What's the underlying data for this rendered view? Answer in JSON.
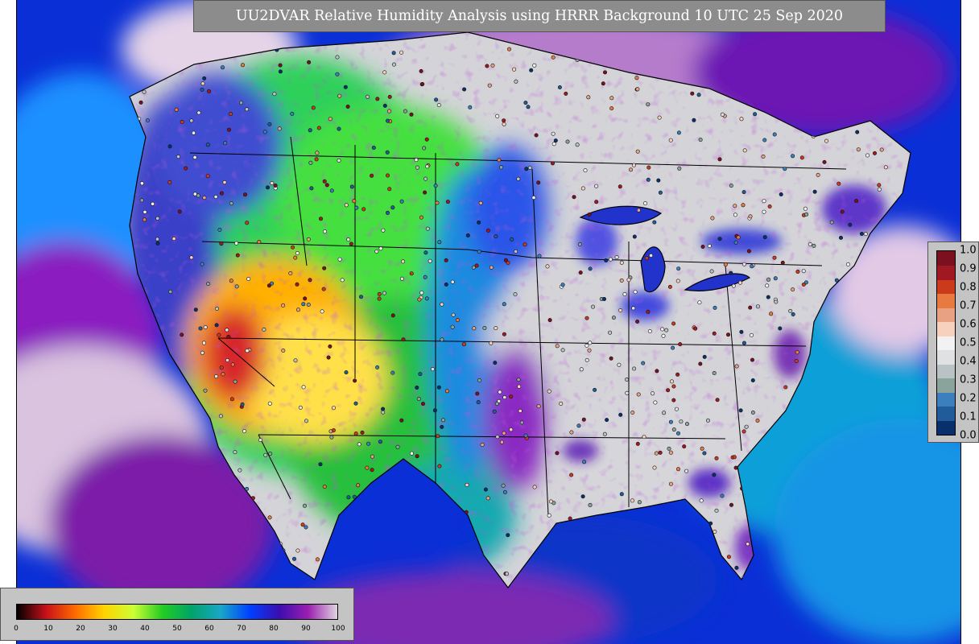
{
  "title": "UU2DVAR Relative Humidity Analysis using HRRR Background 10 UTC 25 Sep 2020",
  "colorbar_rh": {
    "ticks": [
      "0",
      "10",
      "20",
      "30",
      "40",
      "50",
      "60",
      "70",
      "80",
      "90",
      "100"
    ],
    "range": [
      0,
      100
    ],
    "colors": [
      "#000000",
      "#c8101a",
      "#ff6a00",
      "#ffd400",
      "#ccff33",
      "#22cc22",
      "#00a36a",
      "#1aa6c9",
      "#0040ff",
      "#3a0db0",
      "#9b1fb0",
      "#e0d4e0"
    ]
  },
  "colorbar_residual": {
    "ticks": [
      "1.0",
      "0.9",
      "0.8",
      "0.7",
      "0.6",
      "0.5",
      "0.4",
      "0.3",
      "0.2",
      "0.1",
      "0.0"
    ],
    "range": [
      0,
      1
    ],
    "colors": [
      "#08306b",
      "#1f5c99",
      "#3b7fbe",
      "#8aa39b",
      "#b9c2c5",
      "#dfe1e3",
      "#f2f2f2",
      "#f7d0be",
      "#e8a283",
      "#e87a3f",
      "#cc3a1e",
      "#a01822",
      "#7a1020"
    ]
  },
  "map": {
    "background_color": "#0a2fd6",
    "land_dry_color": "#2fd05a",
    "land_very_dry_color": "#ffb000",
    "land_moist_color": "#d4d4d8",
    "ocean_color": "#1280e0"
  }
}
